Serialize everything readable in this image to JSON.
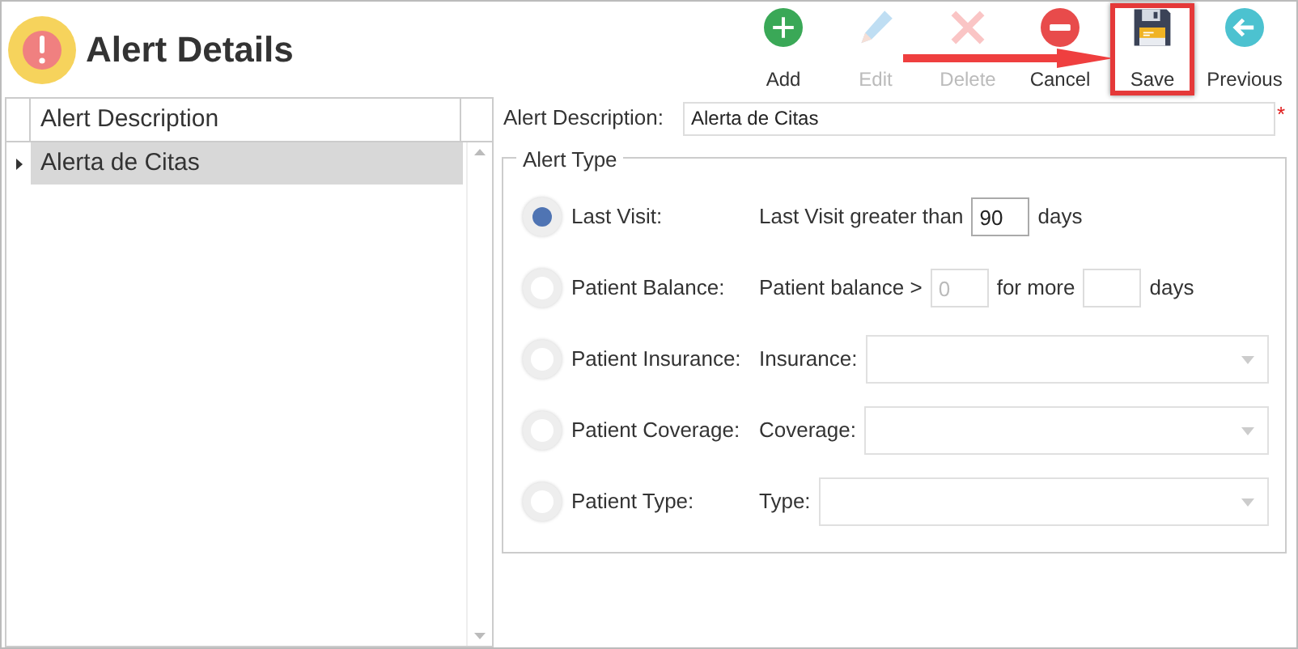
{
  "title": "Alert Details",
  "toolbar": [
    {
      "kind": "add",
      "label": "Add",
      "disabled": false,
      "highlighted": false
    },
    {
      "kind": "edit",
      "label": "Edit",
      "disabled": true,
      "highlighted": false
    },
    {
      "kind": "delete",
      "label": "Delete",
      "disabled": true,
      "highlighted": false
    },
    {
      "kind": "cancel",
      "label": "Cancel",
      "disabled": false,
      "highlighted": false
    },
    {
      "kind": "save",
      "label": "Save",
      "disabled": false,
      "highlighted": true
    },
    {
      "kind": "previous",
      "label": "Previous",
      "disabled": false,
      "highlighted": false
    }
  ],
  "grid": {
    "columns": [
      "Alert Description"
    ],
    "rows": [
      {
        "cells": [
          "Alerta de Citas"
        ],
        "selected": true
      }
    ]
  },
  "description": {
    "label": "Alert Description:",
    "value": "Alerta de Citas",
    "required_mark": "*"
  },
  "alert_type": {
    "title": "Alert Type",
    "options": [
      {
        "label": "Last Visit:",
        "selected": true,
        "fields": [
          {
            "kind": "text",
            "text": "Last Visit greater than"
          },
          {
            "kind": "input",
            "value": "90",
            "disabled": false
          },
          {
            "kind": "text",
            "text": "days"
          }
        ]
      },
      {
        "label": "Patient Balance:",
        "selected": false,
        "fields": [
          {
            "kind": "text",
            "text": "Patient balance >"
          },
          {
            "kind": "input",
            "value": "0",
            "disabled": true
          },
          {
            "kind": "text",
            "text": "for more"
          },
          {
            "kind": "input",
            "disabled": true
          },
          {
            "kind": "text",
            "text": "days"
          }
        ]
      },
      {
        "label": "Patient Insurance:",
        "selected": false,
        "fields": [
          {
            "kind": "text",
            "text": "Insurance:"
          },
          {
            "kind": "select"
          }
        ]
      },
      {
        "label": "Patient Coverage:",
        "selected": false,
        "fields": [
          {
            "kind": "text",
            "text": "Coverage:"
          },
          {
            "kind": "select"
          }
        ]
      },
      {
        "label": "Patient Type:",
        "selected": false,
        "fields": [
          {
            "kind": "text",
            "text": "Type:"
          },
          {
            "kind": "select"
          }
        ]
      }
    ]
  }
}
